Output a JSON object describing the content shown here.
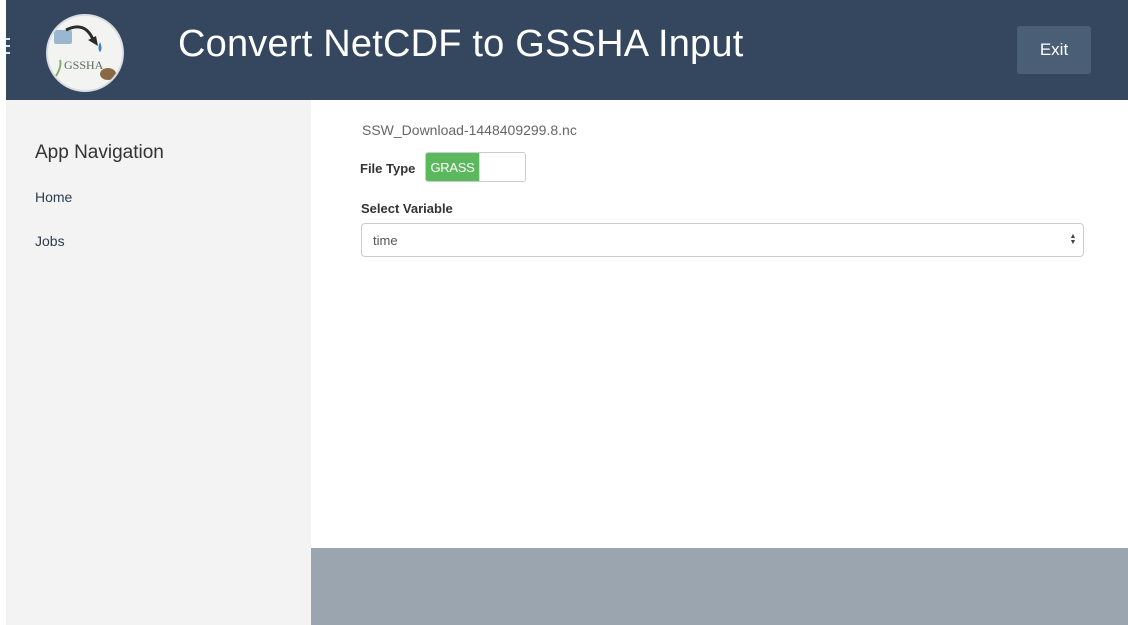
{
  "header": {
    "title": "Convert NetCDF to GSSHA Input",
    "exit_label": "Exit",
    "logo_text": "GSSHA",
    "logo_icon": "gssha-logo",
    "menu_icon": "hamburger-icon",
    "background": "#34475e"
  },
  "sidebar": {
    "title": "App Navigation",
    "items": [
      {
        "label": "Home"
      },
      {
        "label": "Jobs"
      }
    ]
  },
  "main": {
    "file_name": "SSW_Download-1448409299.8.nc",
    "file_type": {
      "label": "File Type",
      "toggle_on_label": "GRASS",
      "state": "on",
      "on_color": "#5cb85c"
    },
    "select_variable": {
      "label": "Select Variable",
      "selected": "time",
      "icon": "select-arrows-icon"
    }
  },
  "colors": {
    "sidebar_bg": "#f3f3f3",
    "footer_bg": "#9ba5af",
    "exit_bg": "#4a5f76"
  }
}
